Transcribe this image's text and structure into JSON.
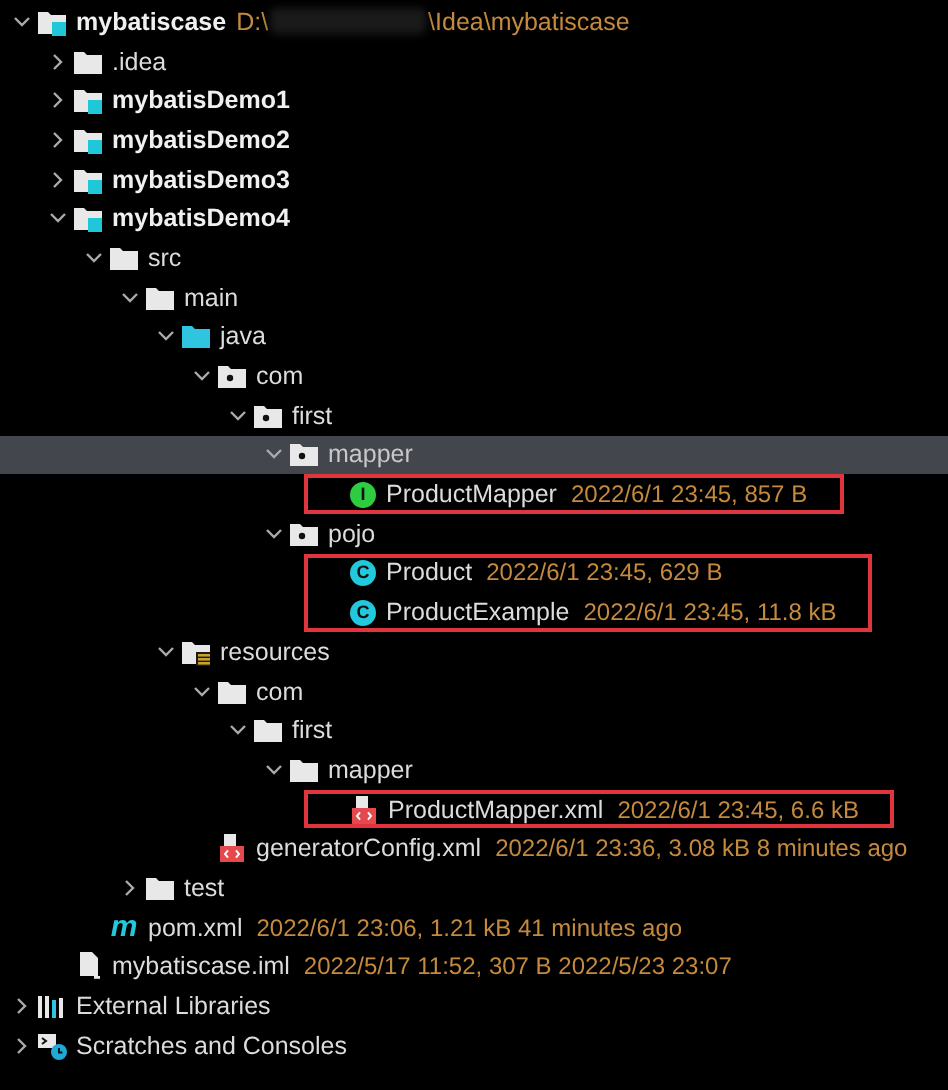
{
  "project_tree": [
    {
      "name": "mybatiscase",
      "kind": "module",
      "expanded": true,
      "selected": false,
      "path_start": "D:\\",
      "path_redacted": true,
      "path_end": "\\Idea\\mybatiscase",
      "children": [
        {
          "name": ".idea",
          "kind": "folder",
          "expanded": false,
          "selected": false
        },
        {
          "name": "mybatisDemo1",
          "kind": "module",
          "expanded": false,
          "selected": false
        },
        {
          "name": "mybatisDemo2",
          "kind": "module",
          "expanded": false,
          "selected": false
        },
        {
          "name": "mybatisDemo3",
          "kind": "module",
          "expanded": false,
          "selected": false
        },
        {
          "name": "mybatisDemo4",
          "kind": "module",
          "expanded": true,
          "selected": false,
          "children": [
            {
              "name": "src",
              "kind": "folder",
              "expanded": true,
              "selected": false,
              "children": [
                {
                  "name": "main",
                  "kind": "folder",
                  "expanded": true,
                  "selected": false,
                  "children": [
                    {
                      "name": "java",
                      "kind": "source",
                      "expanded": true,
                      "selected": false,
                      "children": [
                        {
                          "name": "com",
                          "kind": "package",
                          "expanded": true,
                          "selected": false,
                          "children": [
                            {
                              "name": "first",
                              "kind": "package",
                              "expanded": true,
                              "selected": false,
                              "children": [
                                {
                                  "name": "mapper",
                                  "kind": "package",
                                  "expanded": true,
                                  "selected": true,
                                  "children": [
                                    {
                                      "name": "ProductMapper",
                                      "kind": "interface",
                                      "letter": "I",
                                      "selected": false,
                                      "highlighted": true,
                                      "meta": "2022/6/1 23:45, 857 B"
                                    }
                                  ]
                                },
                                {
                                  "name": "pojo",
                                  "kind": "package",
                                  "expanded": true,
                                  "selected": false,
                                  "children": [
                                    {
                                      "name": "Product",
                                      "kind": "class",
                                      "letter": "C",
                                      "selected": false,
                                      "highlighted": true,
                                      "meta": "2022/6/1 23:45, 629 B"
                                    },
                                    {
                                      "name": "ProductExample",
                                      "kind": "class",
                                      "letter": "C",
                                      "selected": false,
                                      "highlighted": true,
                                      "meta": "2022/6/1 23:45, 11.8 kB"
                                    }
                                  ]
                                }
                              ]
                            }
                          ]
                        }
                      ]
                    },
                    {
                      "name": "resources",
                      "kind": "resources",
                      "expanded": true,
                      "selected": false,
                      "children": [
                        {
                          "name": "com",
                          "kind": "folder",
                          "expanded": true,
                          "selected": false,
                          "children": [
                            {
                              "name": "first",
                              "kind": "folder",
                              "expanded": true,
                              "selected": false,
                              "children": [
                                {
                                  "name": "mapper",
                                  "kind": "folder",
                                  "expanded": true,
                                  "selected": false,
                                  "children": [
                                    {
                                      "name": "ProductMapper.xml",
                                      "kind": "xml",
                                      "selected": false,
                                      "highlighted": true,
                                      "meta": "2022/6/1 23:45, 6.6 kB"
                                    }
                                  ]
                                }
                              ]
                            }
                          ]
                        },
                        {
                          "name": "generatorConfig.xml",
                          "kind": "xml",
                          "selected": false,
                          "highlighted": false,
                          "meta": "2022/6/1 23:36, 3.08 kB 8 minutes ago"
                        }
                      ]
                    }
                  ]
                },
                {
                  "name": "test",
                  "kind": "folder",
                  "expanded": false,
                  "selected": false
                }
              ]
            },
            {
              "name": "pom.xml",
              "kind": "maven",
              "letter": "m",
              "selected": false,
              "highlighted": false,
              "meta": "2022/6/1 23:06, 1.21 kB 41 minutes ago"
            }
          ]
        },
        {
          "name": "mybatiscase.iml",
          "kind": "file",
          "selected": false,
          "highlighted": false,
          "meta": "2022/5/17 11:52, 307 B 2022/5/23 23:07"
        }
      ]
    },
    {
      "name": "External Libraries",
      "kind": "libraries",
      "expanded": false,
      "selected": false
    },
    {
      "name": "Scratches and Consoles",
      "kind": "scratches",
      "expanded": false,
      "selected": false
    }
  ]
}
